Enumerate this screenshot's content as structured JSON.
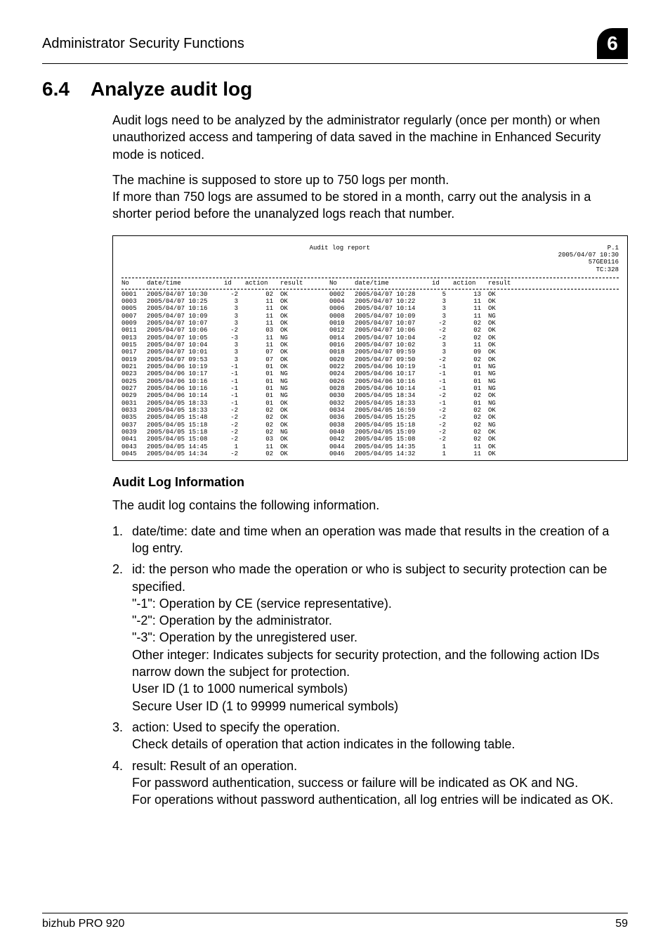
{
  "header": {
    "title": "Administrator Security Functions",
    "badge": "6"
  },
  "section": {
    "number": "6.4",
    "title": "Analyze audit log"
  },
  "intro": {
    "p1": "Audit logs need to be analyzed by the administrator regularly (once per month) or when unauthorized access and tampering of data saved in the machine in Enhanced Security mode is noticed.",
    "p2a": "The machine is supposed to store up to 750 logs per month.",
    "p2b": "If more than 750 logs are assumed to be stored in a month, carry out the analysis in a shorter period before the unanalyzed logs reach that number."
  },
  "report": {
    "title": "Audit log report",
    "meta_p": "P.1",
    "meta_date": "2005/04/07 10:30",
    "meta_serial": "57GE0116",
    "meta_tc": "TC:328",
    "columns": {
      "no": "No",
      "datetime": "date/time",
      "id": "id",
      "action": "action",
      "result": "result"
    },
    "rows": [
      {
        "l": {
          "no": "0001",
          "dt": "2005/04/07 10:30",
          "id": "-2",
          "ac": "02",
          "re": "OK"
        },
        "r": {
          "no": "0002",
          "dt": "2005/04/07 10:28",
          "id": "5",
          "ac": "13",
          "re": "OK"
        }
      },
      {
        "l": {
          "no": "0003",
          "dt": "2005/04/07 10:25",
          "id": "3",
          "ac": "11",
          "re": "OK"
        },
        "r": {
          "no": "0004",
          "dt": "2005/04/07 10:22",
          "id": "3",
          "ac": "11",
          "re": "OK"
        }
      },
      {
        "l": {
          "no": "0005",
          "dt": "2005/04/07 10:16",
          "id": "3",
          "ac": "11",
          "re": "OK"
        },
        "r": {
          "no": "0006",
          "dt": "2005/04/07 10:14",
          "id": "3",
          "ac": "11",
          "re": "OK"
        }
      },
      {
        "l": {
          "no": "0007",
          "dt": "2005/04/07 10:09",
          "id": "3",
          "ac": "11",
          "re": "OK"
        },
        "r": {
          "no": "0008",
          "dt": "2005/04/07 10:09",
          "id": "3",
          "ac": "11",
          "re": "NG"
        }
      },
      {
        "l": {
          "no": "0009",
          "dt": "2005/04/07 10:07",
          "id": "3",
          "ac": "11",
          "re": "OK"
        },
        "r": {
          "no": "0010",
          "dt": "2005/04/07 10:07",
          "id": "-2",
          "ac": "02",
          "re": "OK"
        }
      },
      {
        "l": {
          "no": "0011",
          "dt": "2005/04/07 10:06",
          "id": "-2",
          "ac": "03",
          "re": "OK"
        },
        "r": {
          "no": "0012",
          "dt": "2005/04/07 10:06",
          "id": "-2",
          "ac": "02",
          "re": "OK"
        }
      },
      {
        "l": {
          "no": "0013",
          "dt": "2005/04/07 10:05",
          "id": "-3",
          "ac": "11",
          "re": "NG"
        },
        "r": {
          "no": "0014",
          "dt": "2005/04/07 10:04",
          "id": "-2",
          "ac": "02",
          "re": "OK"
        }
      },
      {
        "l": {
          "no": "0015",
          "dt": "2005/04/07 10:04",
          "id": "3",
          "ac": "11",
          "re": "OK"
        },
        "r": {
          "no": "0016",
          "dt": "2005/04/07 10:02",
          "id": "3",
          "ac": "11",
          "re": "OK"
        }
      },
      {
        "l": {
          "no": "0017",
          "dt": "2005/04/07 10:01",
          "id": "3",
          "ac": "07",
          "re": "OK"
        },
        "r": {
          "no": "0018",
          "dt": "2005/04/07 09:59",
          "id": "3",
          "ac": "09",
          "re": "OK"
        }
      },
      {
        "l": {
          "no": "0019",
          "dt": "2005/04/07 09:53",
          "id": "3",
          "ac": "07",
          "re": "OK"
        },
        "r": {
          "no": "0020",
          "dt": "2005/04/07 09:50",
          "id": "-2",
          "ac": "02",
          "re": "OK"
        }
      },
      {
        "l": {
          "no": "0021",
          "dt": "2005/04/06 10:19",
          "id": "-1",
          "ac": "01",
          "re": "OK"
        },
        "r": {
          "no": "0022",
          "dt": "2005/04/06 10:19",
          "id": "-1",
          "ac": "01",
          "re": "NG"
        }
      },
      {
        "l": {
          "no": "0023",
          "dt": "2005/04/06 10:17",
          "id": "-1",
          "ac": "01",
          "re": "NG"
        },
        "r": {
          "no": "0024",
          "dt": "2005/04/06 10:17",
          "id": "-1",
          "ac": "01",
          "re": "NG"
        }
      },
      {
        "l": {
          "no": "0025",
          "dt": "2005/04/06 10:16",
          "id": "-1",
          "ac": "01",
          "re": "NG"
        },
        "r": {
          "no": "0026",
          "dt": "2005/04/06 10:16",
          "id": "-1",
          "ac": "01",
          "re": "NG"
        }
      },
      {
        "l": {
          "no": "0027",
          "dt": "2005/04/06 10:16",
          "id": "-1",
          "ac": "01",
          "re": "NG"
        },
        "r": {
          "no": "0028",
          "dt": "2005/04/06 10:14",
          "id": "-1",
          "ac": "01",
          "re": "NG"
        }
      },
      {
        "l": {
          "no": "0029",
          "dt": "2005/04/06 10:14",
          "id": "-1",
          "ac": "01",
          "re": "NG"
        },
        "r": {
          "no": "0030",
          "dt": "2005/04/05 18:34",
          "id": "-2",
          "ac": "02",
          "re": "OK"
        }
      },
      {
        "l": {
          "no": "0031",
          "dt": "2005/04/05 18:33",
          "id": "-1",
          "ac": "01",
          "re": "OK"
        },
        "r": {
          "no": "0032",
          "dt": "2005/04/05 18:33",
          "id": "-1",
          "ac": "01",
          "re": "NG"
        }
      },
      {
        "l": {
          "no": "0033",
          "dt": "2005/04/05 18:33",
          "id": "-2",
          "ac": "02",
          "re": "OK"
        },
        "r": {
          "no": "0034",
          "dt": "2005/04/05 16:59",
          "id": "-2",
          "ac": "02",
          "re": "OK"
        }
      },
      {
        "l": {
          "no": "0035",
          "dt": "2005/04/05 15:48",
          "id": "-2",
          "ac": "02",
          "re": "OK"
        },
        "r": {
          "no": "0036",
          "dt": "2005/04/05 15:25",
          "id": "-2",
          "ac": "02",
          "re": "OK"
        }
      },
      {
        "l": {
          "no": "0037",
          "dt": "2005/04/05 15:18",
          "id": "-2",
          "ac": "02",
          "re": "OK"
        },
        "r": {
          "no": "0038",
          "dt": "2005/04/05 15:18",
          "id": "-2",
          "ac": "02",
          "re": "NG"
        }
      },
      {
        "l": {
          "no": "0039",
          "dt": "2005/04/05 15:18",
          "id": "-2",
          "ac": "02",
          "re": "NG"
        },
        "r": {
          "no": "0040",
          "dt": "2005/04/05 15:09",
          "id": "-2",
          "ac": "02",
          "re": "OK"
        }
      },
      {
        "l": {
          "no": "0041",
          "dt": "2005/04/05 15:08",
          "id": "-2",
          "ac": "03",
          "re": "OK"
        },
        "r": {
          "no": "0042",
          "dt": "2005/04/05 15:08",
          "id": "-2",
          "ac": "02",
          "re": "OK"
        }
      },
      {
        "l": {
          "no": "0043",
          "dt": "2005/04/05 14:45",
          "id": "1",
          "ac": "11",
          "re": "OK"
        },
        "r": {
          "no": "0044",
          "dt": "2005/04/05 14:35",
          "id": "1",
          "ac": "11",
          "re": "OK"
        }
      },
      {
        "l": {
          "no": "0045",
          "dt": "2005/04/05 14:34",
          "id": "-2",
          "ac": "02",
          "re": "OK"
        },
        "r": {
          "no": "0046",
          "dt": "2005/04/05 14:32",
          "id": "1",
          "ac": "11",
          "re": "OK"
        }
      }
    ]
  },
  "info": {
    "heading": "Audit Log Information",
    "intro": "The audit log contains the following information.",
    "items": {
      "i1": {
        "num": "1.",
        "text": "date/time: date and time when an operation was made that results in the creation of a log entry."
      },
      "i2": {
        "num": "2.",
        "text": "id: the person who made the operation or who is subject to security protection can be specified.",
        "l1": "\"-1\": Operation by CE (service representative).",
        "l2": "\"-2\": Operation by the administrator.",
        "l3": "\"-3\": Operation by the unregistered user.",
        "l4": "Other integer: Indicates subjects for security protection, and the following action IDs narrow down the subject for protection.",
        "l5": "User ID (1 to 1000 numerical symbols)",
        "l6": "Secure User ID (1 to 99999 numerical symbols)"
      },
      "i3": {
        "num": "3.",
        "text": "action: Used to specify the operation.",
        "l1": "Check details of operation that action indicates in the following table."
      },
      "i4": {
        "num": "4.",
        "text": "result: Result of an operation.",
        "l1": "For password authentication, success or failure will be indicated as OK and NG.",
        "l2": "For operations without password authentication, all log entries will be indicated as OK."
      }
    }
  },
  "footer": {
    "left": "bizhub PRO 920",
    "right": "59"
  }
}
